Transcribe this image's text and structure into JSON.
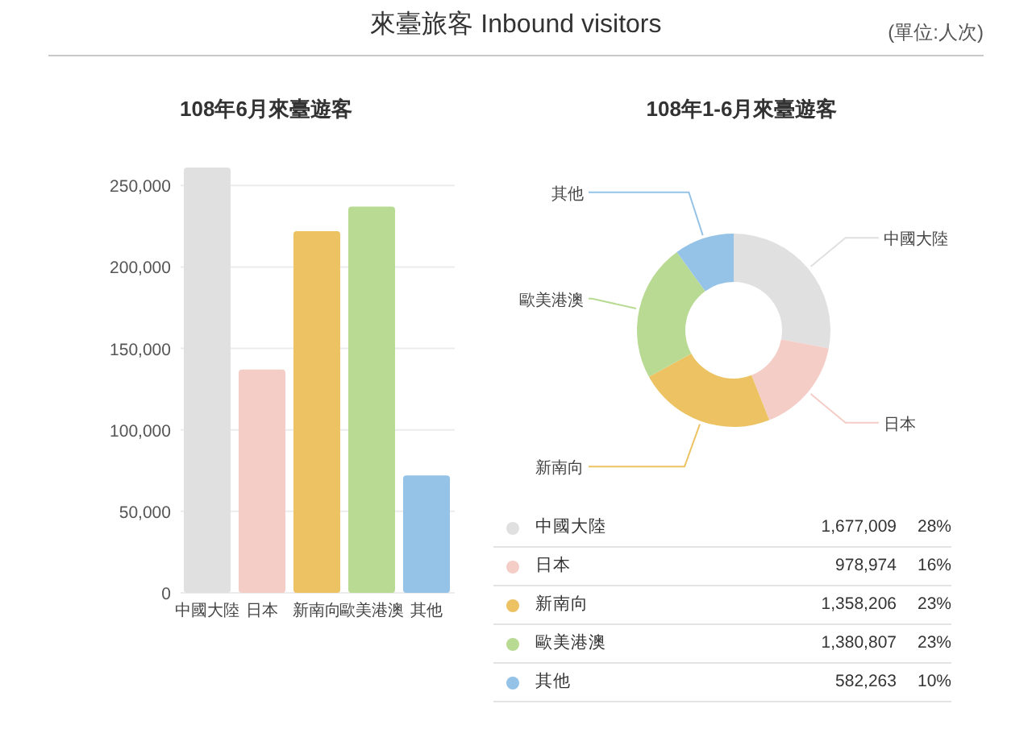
{
  "header": {
    "title": "來臺旅客 Inbound visitors",
    "unit": "(單位:人次)"
  },
  "monthly": {
    "title": "108年6月來臺遊客",
    "chart_data": {
      "type": "bar",
      "categories": [
        "中國大陸",
        "日本",
        "新南向",
        "歐美港澳",
        "其他"
      ],
      "colors": [
        "#e1e0e0",
        "#f4cdc6",
        "#ecc262",
        "#b9da93",
        "#95c3e8"
      ],
      "values": [
        261000,
        137000,
        222000,
        237000,
        72000
      ],
      "grid": true,
      "ylim": [
        0,
        262000
      ],
      "yticks": [
        {
          "value": 0,
          "label": "0"
        },
        {
          "value": 50000,
          "label": "50,000"
        },
        {
          "value": 100000,
          "label": "100,000"
        },
        {
          "value": 150000,
          "label": "150,000"
        },
        {
          "value": 200000,
          "label": "200,000"
        },
        {
          "value": 250000,
          "label": "250,000"
        }
      ]
    }
  },
  "half_year": {
    "title": "108年1-6月來臺遊客",
    "chart_data": {
      "type": "donut",
      "categories": [
        "中國大陸",
        "日本",
        "新南向",
        "歐美港澳",
        "其他"
      ],
      "colors": [
        "#e1e0e0",
        "#f4cdc6",
        "#ecc262",
        "#b9da93",
        "#95c3e8"
      ],
      "values": [
        28,
        16,
        23,
        23,
        10
      ]
    },
    "legend": [
      {
        "name": "中國大陸",
        "value": "1,677,009",
        "share": "28%",
        "color": "#e1e0e0"
      },
      {
        "name": "日本",
        "value": "978,974",
        "share": "16%",
        "color": "#f4cdc6"
      },
      {
        "name": "新南向",
        "value": "1,358,206",
        "share": "23%",
        "color": "#ecc262"
      },
      {
        "name": "歐美港澳",
        "value": "1,380,807",
        "share": "23%",
        "color": "#b9da93"
      },
      {
        "name": "其他",
        "value": "582,263",
        "share": "10%",
        "color": "#95c3e8"
      }
    ]
  }
}
